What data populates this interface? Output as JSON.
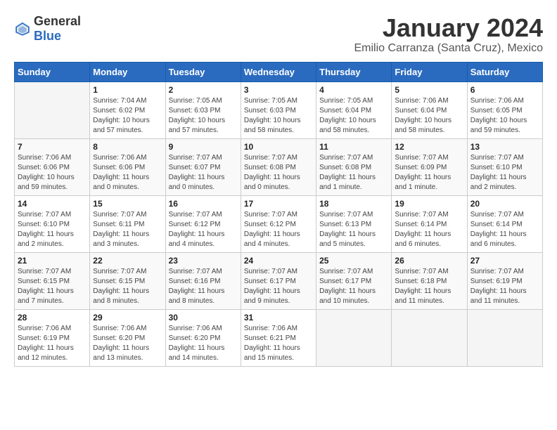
{
  "header": {
    "logo_general": "General",
    "logo_blue": "Blue",
    "title": "January 2024",
    "subtitle": "Emilio Carranza (Santa Cruz), Mexico"
  },
  "days_of_week": [
    "Sunday",
    "Monday",
    "Tuesday",
    "Wednesday",
    "Thursday",
    "Friday",
    "Saturday"
  ],
  "weeks": [
    [
      {
        "num": "",
        "info": ""
      },
      {
        "num": "1",
        "info": "Sunrise: 7:04 AM\nSunset: 6:02 PM\nDaylight: 10 hours\nand 57 minutes."
      },
      {
        "num": "2",
        "info": "Sunrise: 7:05 AM\nSunset: 6:03 PM\nDaylight: 10 hours\nand 57 minutes."
      },
      {
        "num": "3",
        "info": "Sunrise: 7:05 AM\nSunset: 6:03 PM\nDaylight: 10 hours\nand 58 minutes."
      },
      {
        "num": "4",
        "info": "Sunrise: 7:05 AM\nSunset: 6:04 PM\nDaylight: 10 hours\nand 58 minutes."
      },
      {
        "num": "5",
        "info": "Sunrise: 7:06 AM\nSunset: 6:04 PM\nDaylight: 10 hours\nand 58 minutes."
      },
      {
        "num": "6",
        "info": "Sunrise: 7:06 AM\nSunset: 6:05 PM\nDaylight: 10 hours\nand 59 minutes."
      }
    ],
    [
      {
        "num": "7",
        "info": "Sunrise: 7:06 AM\nSunset: 6:06 PM\nDaylight: 10 hours\nand 59 minutes."
      },
      {
        "num": "8",
        "info": "Sunrise: 7:06 AM\nSunset: 6:06 PM\nDaylight: 11 hours\nand 0 minutes."
      },
      {
        "num": "9",
        "info": "Sunrise: 7:07 AM\nSunset: 6:07 PM\nDaylight: 11 hours\nand 0 minutes."
      },
      {
        "num": "10",
        "info": "Sunrise: 7:07 AM\nSunset: 6:08 PM\nDaylight: 11 hours\nand 0 minutes."
      },
      {
        "num": "11",
        "info": "Sunrise: 7:07 AM\nSunset: 6:08 PM\nDaylight: 11 hours\nand 1 minute."
      },
      {
        "num": "12",
        "info": "Sunrise: 7:07 AM\nSunset: 6:09 PM\nDaylight: 11 hours\nand 1 minute."
      },
      {
        "num": "13",
        "info": "Sunrise: 7:07 AM\nSunset: 6:10 PM\nDaylight: 11 hours\nand 2 minutes."
      }
    ],
    [
      {
        "num": "14",
        "info": "Sunrise: 7:07 AM\nSunset: 6:10 PM\nDaylight: 11 hours\nand 2 minutes."
      },
      {
        "num": "15",
        "info": "Sunrise: 7:07 AM\nSunset: 6:11 PM\nDaylight: 11 hours\nand 3 minutes."
      },
      {
        "num": "16",
        "info": "Sunrise: 7:07 AM\nSunset: 6:12 PM\nDaylight: 11 hours\nand 4 minutes."
      },
      {
        "num": "17",
        "info": "Sunrise: 7:07 AM\nSunset: 6:12 PM\nDaylight: 11 hours\nand 4 minutes."
      },
      {
        "num": "18",
        "info": "Sunrise: 7:07 AM\nSunset: 6:13 PM\nDaylight: 11 hours\nand 5 minutes."
      },
      {
        "num": "19",
        "info": "Sunrise: 7:07 AM\nSunset: 6:14 PM\nDaylight: 11 hours\nand 6 minutes."
      },
      {
        "num": "20",
        "info": "Sunrise: 7:07 AM\nSunset: 6:14 PM\nDaylight: 11 hours\nand 6 minutes."
      }
    ],
    [
      {
        "num": "21",
        "info": "Sunrise: 7:07 AM\nSunset: 6:15 PM\nDaylight: 11 hours\nand 7 minutes."
      },
      {
        "num": "22",
        "info": "Sunrise: 7:07 AM\nSunset: 6:15 PM\nDaylight: 11 hours\nand 8 minutes."
      },
      {
        "num": "23",
        "info": "Sunrise: 7:07 AM\nSunset: 6:16 PM\nDaylight: 11 hours\nand 8 minutes."
      },
      {
        "num": "24",
        "info": "Sunrise: 7:07 AM\nSunset: 6:17 PM\nDaylight: 11 hours\nand 9 minutes."
      },
      {
        "num": "25",
        "info": "Sunrise: 7:07 AM\nSunset: 6:17 PM\nDaylight: 11 hours\nand 10 minutes."
      },
      {
        "num": "26",
        "info": "Sunrise: 7:07 AM\nSunset: 6:18 PM\nDaylight: 11 hours\nand 11 minutes."
      },
      {
        "num": "27",
        "info": "Sunrise: 7:07 AM\nSunset: 6:19 PM\nDaylight: 11 hours\nand 11 minutes."
      }
    ],
    [
      {
        "num": "28",
        "info": "Sunrise: 7:06 AM\nSunset: 6:19 PM\nDaylight: 11 hours\nand 12 minutes."
      },
      {
        "num": "29",
        "info": "Sunrise: 7:06 AM\nSunset: 6:20 PM\nDaylight: 11 hours\nand 13 minutes."
      },
      {
        "num": "30",
        "info": "Sunrise: 7:06 AM\nSunset: 6:20 PM\nDaylight: 11 hours\nand 14 minutes."
      },
      {
        "num": "31",
        "info": "Sunrise: 7:06 AM\nSunset: 6:21 PM\nDaylight: 11 hours\nand 15 minutes."
      },
      {
        "num": "",
        "info": ""
      },
      {
        "num": "",
        "info": ""
      },
      {
        "num": "",
        "info": ""
      }
    ]
  ]
}
